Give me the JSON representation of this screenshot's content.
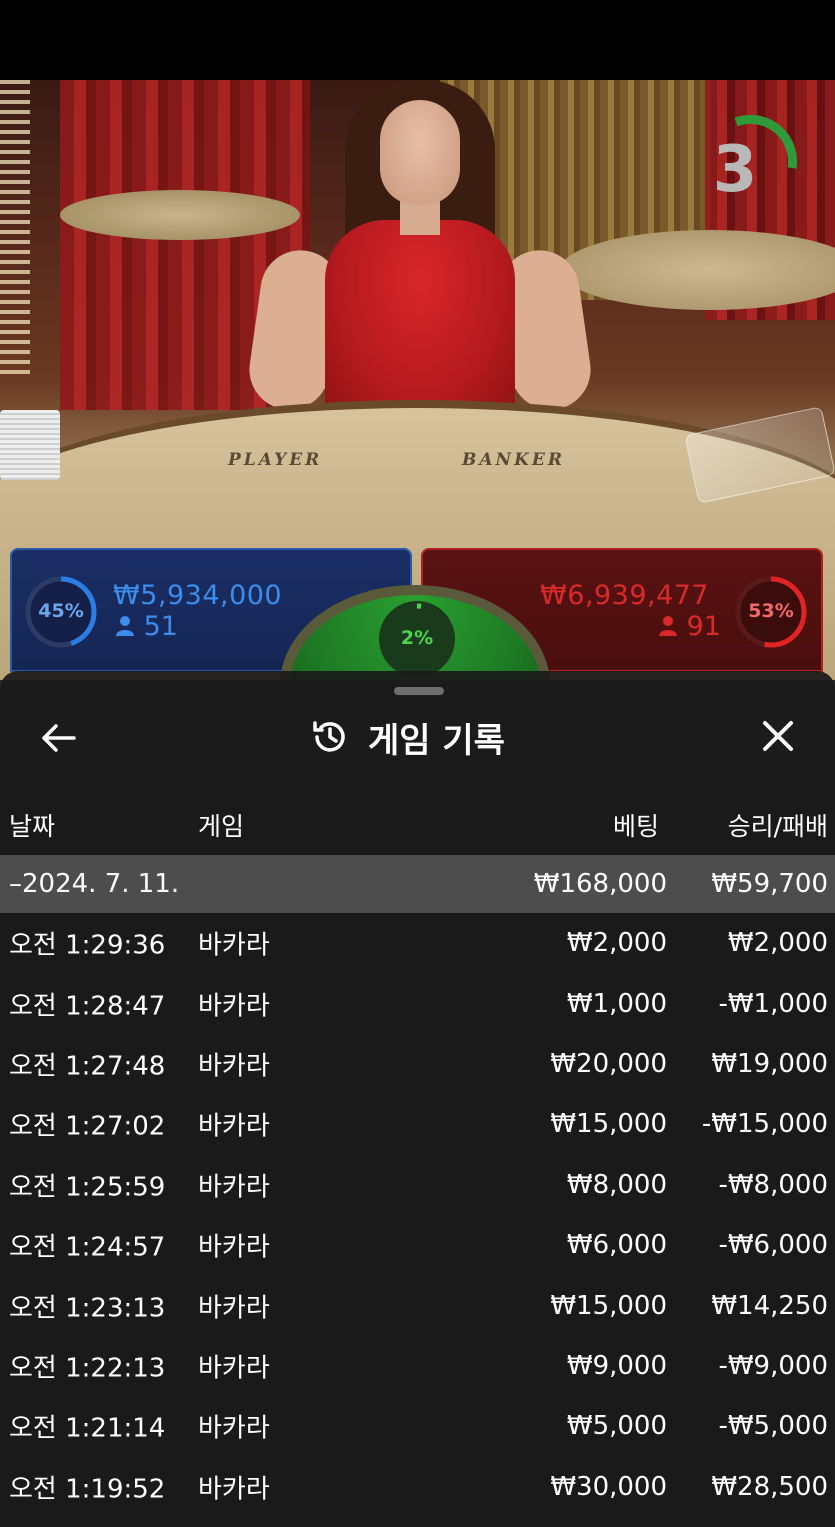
{
  "timer": {
    "seconds": "3"
  },
  "table": {
    "player_label": "PLAYER",
    "banker_label": "BANKER"
  },
  "bets": {
    "player": {
      "percent": "45%",
      "amount": "₩5,934,000",
      "players": "51",
      "fraction": 0.45,
      "color": "#2a7de1"
    },
    "banker": {
      "percent": "53%",
      "amount": "₩6,939,477",
      "players": "91",
      "fraction": 0.53,
      "color": "#e02424"
    },
    "tie": {
      "percent": "2%",
      "fraction": 0.02,
      "color": "#4cd44c"
    }
  },
  "sheet": {
    "title": "게임 기록",
    "columns": {
      "date": "날짜",
      "game": "게임",
      "bet": "베팅",
      "result": "승리/패배"
    },
    "date_group": {
      "label": "–2024. 7. 11.",
      "bet_total": "₩168,000",
      "result_total": "₩59,700"
    },
    "rows": [
      {
        "time": "오전 1:29:36",
        "game": "바카라",
        "bet": "₩2,000",
        "result": "₩2,000"
      },
      {
        "time": "오전 1:28:47",
        "game": "바카라",
        "bet": "₩1,000",
        "result": "-₩1,000"
      },
      {
        "time": "오전 1:27:48",
        "game": "바카라",
        "bet": "₩20,000",
        "result": "₩19,000"
      },
      {
        "time": "오전 1:27:02",
        "game": "바카라",
        "bet": "₩15,000",
        "result": "-₩15,000"
      },
      {
        "time": "오전 1:25:59",
        "game": "바카라",
        "bet": "₩8,000",
        "result": "-₩8,000"
      },
      {
        "time": "오전 1:24:57",
        "game": "바카라",
        "bet": "₩6,000",
        "result": "-₩6,000"
      },
      {
        "time": "오전 1:23:13",
        "game": "바카라",
        "bet": "₩15,000",
        "result": "₩14,250"
      },
      {
        "time": "오전 1:22:13",
        "game": "바카라",
        "bet": "₩9,000",
        "result": "-₩9,000"
      },
      {
        "time": "오전 1:21:14",
        "game": "바카라",
        "bet": "₩5,000",
        "result": "-₩5,000"
      },
      {
        "time": "오전 1:19:52",
        "game": "바카라",
        "bet": "₩30,000",
        "result": "₩28,500"
      }
    ]
  }
}
